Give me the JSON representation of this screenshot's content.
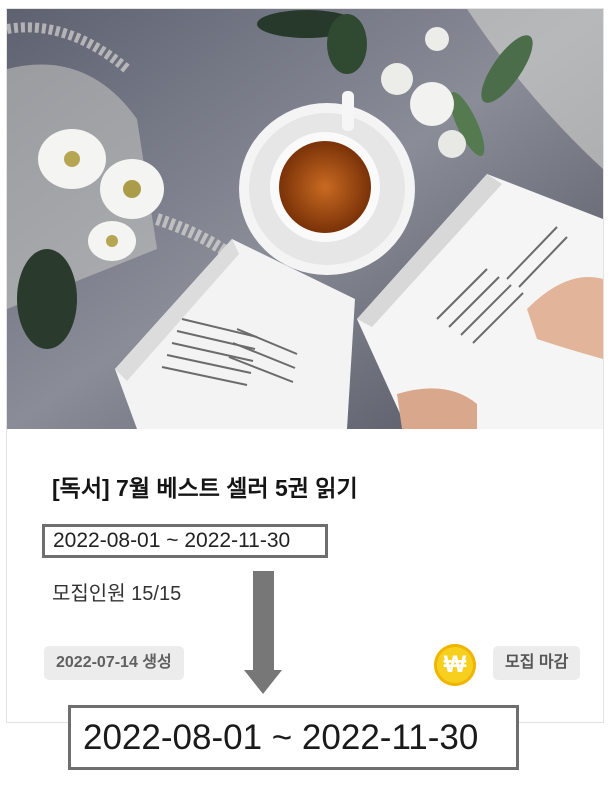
{
  "card": {
    "title": "[독서] 7월 베스트 셀러 5권 읽기",
    "date_range": "2022-08-01 ~ 2022-11-30",
    "recruit": "모집인원 15/15",
    "created": "2022-07-14 생성",
    "price_icon": "₩",
    "status": "모집 마감",
    "colors": {
      "price_icon": "#f7cf1f",
      "badge_bg": "#ececec",
      "highlight_border": "#6e6e6e"
    }
  },
  "callout": {
    "zoom_text": "2022-08-01 ~ 2022-11-30"
  }
}
